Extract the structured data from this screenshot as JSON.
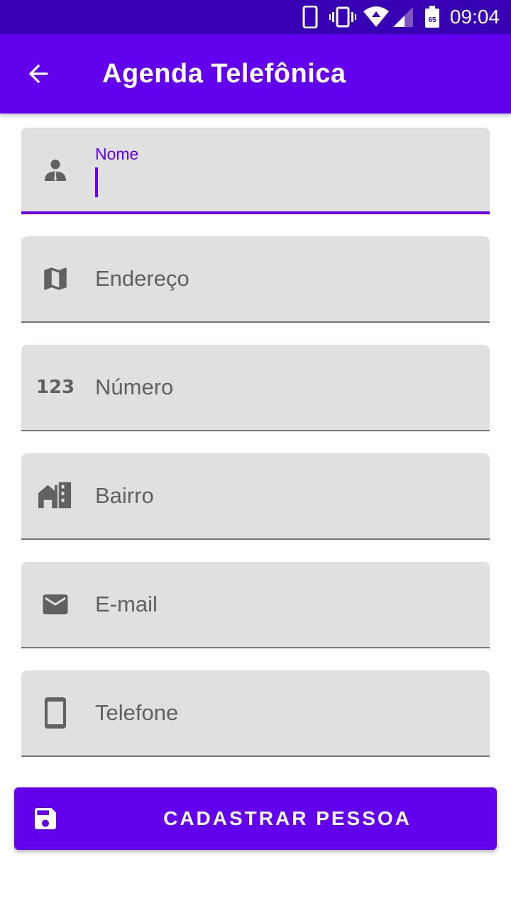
{
  "status_bar": {
    "time": "09:04",
    "battery_level": "65",
    "icons": [
      "phone-icon",
      "vibrate-icon",
      "wifi-icon",
      "cell-signal-icon",
      "battery-icon"
    ]
  },
  "app_bar": {
    "title": "Agenda Telefônica",
    "back_icon": "arrow-back-icon"
  },
  "form": {
    "fields": [
      {
        "key": "nome",
        "label": "Nome",
        "icon": "person-icon",
        "focused": true,
        "value": ""
      },
      {
        "key": "endereco",
        "placeholder": "Endereço",
        "icon": "map-icon",
        "value": ""
      },
      {
        "key": "numero",
        "placeholder": "Número",
        "icon": "numbers-123-icon",
        "icon_text": "123",
        "value": ""
      },
      {
        "key": "bairro",
        "placeholder": "Bairro",
        "icon": "location-city-icon",
        "value": ""
      },
      {
        "key": "email",
        "placeholder": "E-mail",
        "icon": "email-icon",
        "value": ""
      },
      {
        "key": "telefone",
        "placeholder": "Telefone",
        "icon": "smartphone-icon",
        "value": ""
      }
    ]
  },
  "submit": {
    "label": "CADASTRAR PESSOA",
    "icon": "save-icon"
  },
  "colors": {
    "primary": "#6200ee",
    "primary_dark": "#3700b3",
    "field_bg": "#e0e0e0",
    "icon_gray": "#616161"
  }
}
